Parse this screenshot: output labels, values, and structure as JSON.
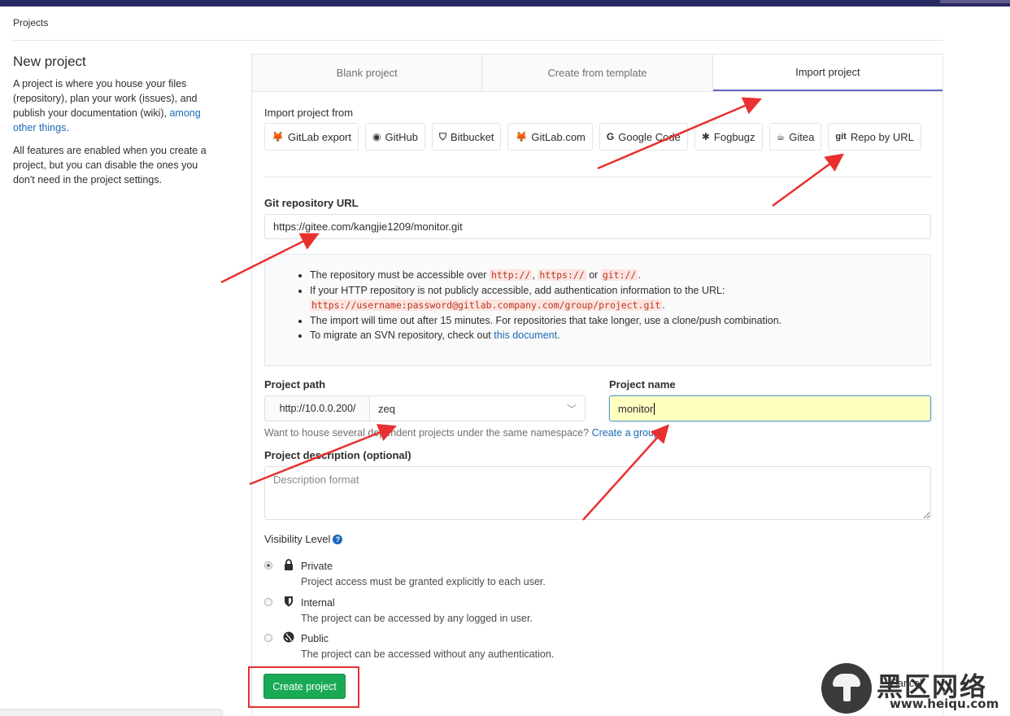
{
  "breadcrumb": "Projects",
  "aside": {
    "title": "New project",
    "para1_text": "A project is where you house your files (repository), plan your work (issues), and publish your documentation (wiki), ",
    "para1_link": "among other things",
    "para1_end": ".",
    "para2": "All features are enabled when you create a project, but you can disable the ones you don't need in the project settings."
  },
  "tabs": [
    {
      "label": "Blank project"
    },
    {
      "label": "Create from template"
    },
    {
      "label": "Import project"
    }
  ],
  "import": {
    "heading": "Import project from",
    "buttons": [
      {
        "label": "GitLab export",
        "icon": "gitlab-icon"
      },
      {
        "label": "GitHub",
        "icon": "github-icon"
      },
      {
        "label": "Bitbucket",
        "icon": "bitbucket-icon"
      },
      {
        "label": "GitLab.com",
        "icon": "gitlab-icon"
      },
      {
        "label": "Google Code",
        "icon": "google-icon"
      },
      {
        "label": "Fogbugz",
        "icon": "bug-icon"
      },
      {
        "label": "Gitea",
        "icon": "gitea-icon"
      },
      {
        "label": "Repo by URL",
        "icon": "git-icon"
      }
    ]
  },
  "git_url": {
    "label": "Git repository URL",
    "value": "https://gitee.com/kangjie1209/monitor.git"
  },
  "help": {
    "l1_a": "The repository must be accessible over ",
    "l1_c1": "http://",
    "l1_sep1": ", ",
    "l1_c2": "https://",
    "l1_sep2": " or ",
    "l1_c3": "git://",
    "l1_end": ".",
    "l2_a": "If your HTTP repository is not publicly accessible, add authentication information to the URL:",
    "l2_code": "https://username:password@gitlab.company.com/group/project.git",
    "l2_end": ".",
    "l3": "The import will time out after 15 minutes. For repositories that take longer, use a clone/push combination.",
    "l4_a": "To migrate an SVN repository, check out ",
    "l4_link": "this document",
    "l4_end": "."
  },
  "project_path": {
    "label": "Project path",
    "prefix": "http://10.0.0.200/",
    "namespace": "zeq"
  },
  "project_name": {
    "label": "Project name",
    "value": "monitor"
  },
  "hint": {
    "text": "Want to house several dependent projects under the same namespace? ",
    "link": "Create a group."
  },
  "description": {
    "label": "Project description (optional)",
    "placeholder": "Description format"
  },
  "visibility": {
    "label": "Visibility Level",
    "help_glyph": "?",
    "options": [
      {
        "title": "Private",
        "desc": "Project access must be granted explicitly to each user.",
        "checked": true
      },
      {
        "title": "Internal",
        "desc": "The project can be accessed by any logged in user.",
        "checked": false
      },
      {
        "title": "Public",
        "desc": "The project can be accessed without any authentication.",
        "checked": false
      }
    ]
  },
  "actions": {
    "create": "Create project",
    "cancel": "Cancel"
  },
  "watermark": {
    "title": "黑区网络",
    "url": "www.heiqu.com"
  },
  "colors": {
    "accent": "#6666c4",
    "create_button": "#1aaa55",
    "annotation": "#e8312f",
    "link": "#1b69b6"
  }
}
